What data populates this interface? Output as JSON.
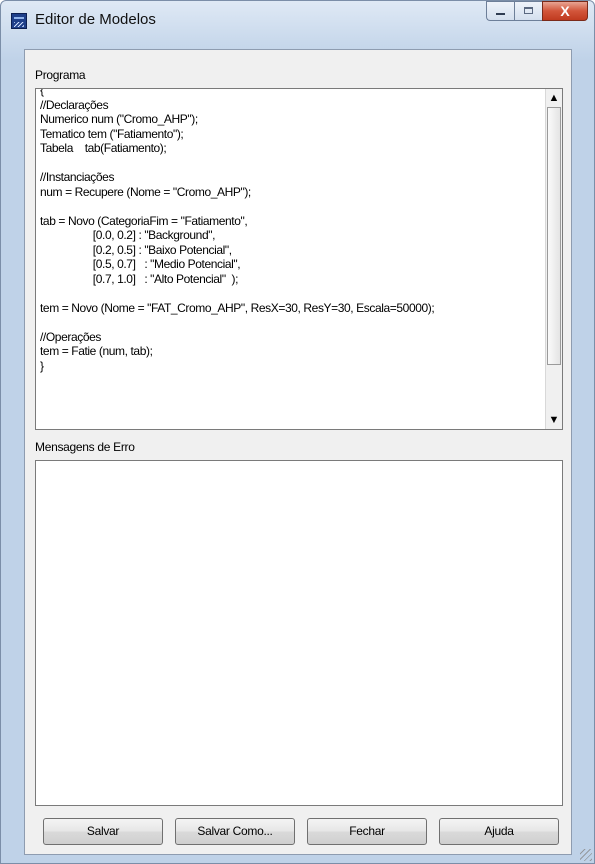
{
  "window": {
    "title": "Editor de Modelos",
    "caption": {
      "minimize": "–",
      "maximize": "□",
      "close": "X"
    }
  },
  "program": {
    "label": "Programa",
    "lines": [
      "{",
      "//Declarações",
      "Numerico num (\"Cromo_AHP\");",
      "Tematico tem (\"Fatiamento\");",
      "Tabela    tab(Fatiamento);",
      "",
      "//Instanciações",
      "num = Recupere (Nome = \"Cromo_AHP\");",
      "",
      "tab = Novo (CategoriaFim = \"Fatiamento\",",
      "                  [0.0, 0.2] : \"Background\",",
      "                  [0.2, 0.5] : \"Baixo Potencial\",",
      "                  [0.5, 0.7]   : \"Medio Potencial\",",
      "                  [0.7, 1.0]   : \"Alto Potencial\"  );",
      "",
      "tem = Novo (Nome = \"FAT_Cromo_AHP\", ResX=30, ResY=30, Escala=50000);",
      "",
      "//Operações",
      "tem = Fatie (num, tab);",
      "}"
    ]
  },
  "errors": {
    "label": "Mensagens de Erro",
    "text": ""
  },
  "buttons": {
    "save": "Salvar",
    "save_as": "Salvar Como...",
    "close": "Fechar",
    "help": "Ajuda"
  }
}
